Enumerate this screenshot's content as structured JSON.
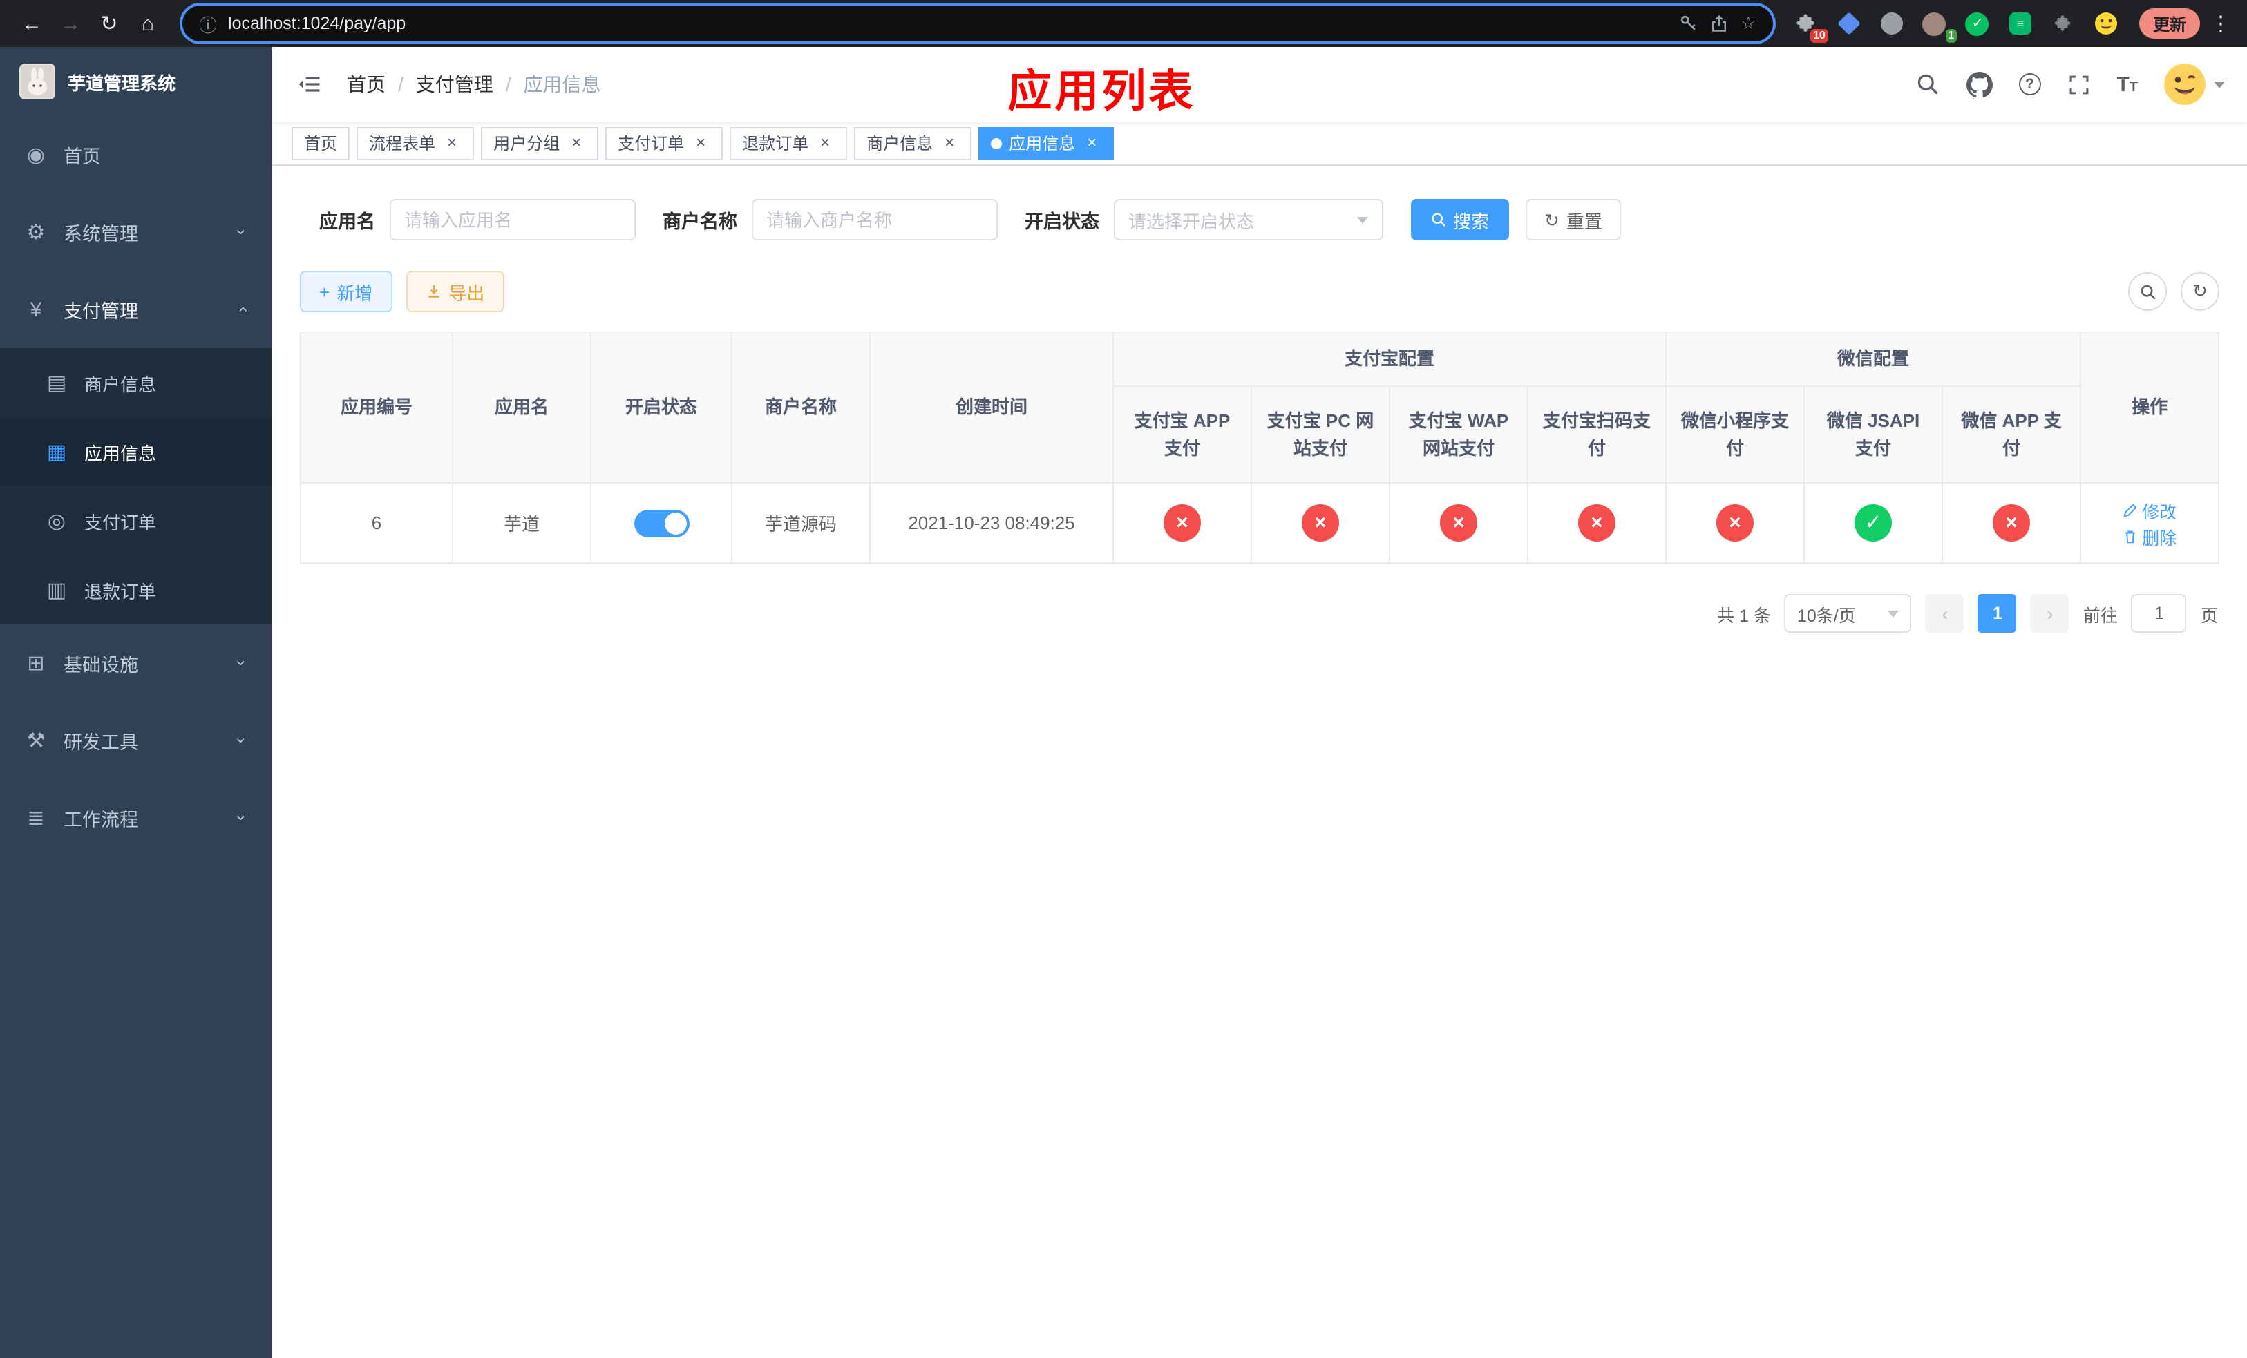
{
  "browser": {
    "url": "localhost:1024/pay/app",
    "update_label": "更新",
    "extensions_badge": "10",
    "avatar_ext_badge": "1"
  },
  "overlay_title": "应用列表",
  "sidebar": {
    "title": "芋道管理系统",
    "menu": [
      {
        "label": "首页",
        "icon_glyph": "◉",
        "icon_name": "dashboard-icon",
        "expandable": false
      },
      {
        "label": "系统管理",
        "icon_glyph": "⚙",
        "icon_name": "gear-icon",
        "expandable": true
      },
      {
        "label": "支付管理",
        "icon_glyph": "¥",
        "icon_name": "yen-icon",
        "expandable": true,
        "expanded": true
      },
      {
        "label": "基础设施",
        "icon_glyph": "⊞",
        "icon_name": "infrastructure-icon",
        "expandable": true
      },
      {
        "label": "研发工具",
        "icon_glyph": "⚒",
        "icon_name": "tools-icon",
        "expandable": true
      },
      {
        "label": "工作流程",
        "icon_glyph": "≣",
        "icon_name": "workflow-icon",
        "expandable": true
      }
    ],
    "submenu_pay": [
      {
        "label": "商户信息",
        "icon_glyph": "▤",
        "icon_name": "merchant-card-icon"
      },
      {
        "label": "应用信息",
        "icon_glyph": "▦",
        "icon_name": "app-grid-icon",
        "active": true
      },
      {
        "label": "支付订单",
        "icon_glyph": "◎",
        "icon_name": "pay-order-icon"
      },
      {
        "label": "退款订单",
        "icon_glyph": "▥",
        "icon_name": "refund-order-icon"
      }
    ]
  },
  "header": {
    "breadcrumb": [
      "首页",
      "支付管理",
      "应用信息"
    ]
  },
  "tabs": [
    {
      "label": "首页",
      "closable": false
    },
    {
      "label": "流程表单",
      "closable": true
    },
    {
      "label": "用户分组",
      "closable": true
    },
    {
      "label": "支付订单",
      "closable": true
    },
    {
      "label": "退款订单",
      "closable": true
    },
    {
      "label": "商户信息",
      "closable": true
    },
    {
      "label": "应用信息",
      "closable": true,
      "active": true
    }
  ],
  "search": {
    "app_name_label": "应用名",
    "app_name_placeholder": "请输入应用名",
    "merchant_label": "商户名称",
    "merchant_placeholder": "请输入商户名称",
    "status_label": "开启状态",
    "status_placeholder": "请选择开启状态",
    "search_button": "搜索",
    "reset_button": "重置"
  },
  "toolbar": {
    "add_button": "新增",
    "export_button": "导出"
  },
  "table": {
    "headers": {
      "app_id": "应用编号",
      "app_name": "应用名",
      "status": "开启状态",
      "merchant": "商户名称",
      "create_time": "创建时间",
      "alipay_group": "支付宝配置",
      "wechat_group": "微信配置",
      "alipay_app": "支付宝 APP 支付",
      "alipay_pc": "支付宝 PC 网站支付",
      "alipay_wap": "支付宝 WAP 网站支付",
      "alipay_qr": "支付宝扫码支付",
      "wechat_mini": "微信小程序支付",
      "wechat_jsapi": "微信 JSAPI 支付",
      "wechat_app": "微信 APP 支付",
      "actions": "操作"
    },
    "row": {
      "app_id": "6",
      "app_name": "芋道",
      "enabled": true,
      "merchant": "芋道源码",
      "create_time": "2021-10-23 08:49:25",
      "alipay_app": false,
      "alipay_pc": false,
      "alipay_wap": false,
      "alipay_qr": false,
      "wechat_mini": false,
      "wechat_jsapi": true,
      "wechat_app": false,
      "edit_label": "修改",
      "delete_label": "删除"
    }
  },
  "pagination": {
    "total": "共 1 条",
    "page_size": "10条/页",
    "current_page": "1",
    "goto_label": "前往",
    "goto_value": "1",
    "goto_unit": "页"
  },
  "icons": {
    "back": "←",
    "forward": "→",
    "reload": "↻",
    "home": "⌂",
    "site_info": "ⓘ",
    "bookmark_star": "☆",
    "kebab_menu": "⋮",
    "plus": "+",
    "refresh": "↻",
    "close": "×",
    "check": "✓",
    "cross": "×",
    "prev": "‹",
    "next": "›",
    "chevron": "›",
    "question": "?"
  },
  "colors": {
    "primary": "#409eff",
    "success": "#13ce66",
    "danger": "#f34d4d",
    "warning": "#e6a23c",
    "sidebar_bg": "#304156",
    "submenu_bg": "#1f2d3d",
    "overlay_title_color": "#ff0000"
  }
}
